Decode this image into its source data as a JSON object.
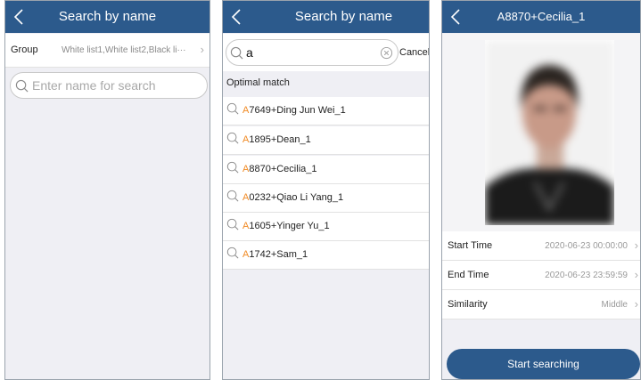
{
  "panel1": {
    "title": "Search by name",
    "group_label": "Group",
    "group_value": "White list1,White list2,Black li···",
    "search_placeholder": "Enter name for search"
  },
  "panel2": {
    "title": "Search by name",
    "search_value": "a",
    "cancel_label": "Cancel",
    "section_label": "Optimal match",
    "results": [
      {
        "highlight": "A",
        "rest": "7649+Ding Jun Wei_1"
      },
      {
        "highlight": "A",
        "rest": "1895+Dean_1"
      },
      {
        "highlight": "A",
        "rest": "8870+Cecilia_1"
      },
      {
        "highlight": "A",
        "rest": "0232+Qiao Li Yang_1"
      },
      {
        "highlight": "A",
        "rest": "1605+Yinger Yu_1"
      },
      {
        "highlight": "A",
        "rest": "1742+Sam_1"
      }
    ]
  },
  "panel3": {
    "title": "A8870+Cecilia_1",
    "start_time_label": "Start Time",
    "start_time_value": "2020-06-23 00:00:00",
    "end_time_label": "End Time",
    "end_time_value": "2020-06-23 23:59:59",
    "similarity_label": "Similarity",
    "similarity_value": "Middle",
    "button_label": "Start searching"
  },
  "colors": {
    "header": "#2c5a8c",
    "highlight": "#f08a24",
    "background": "#efeff4"
  }
}
